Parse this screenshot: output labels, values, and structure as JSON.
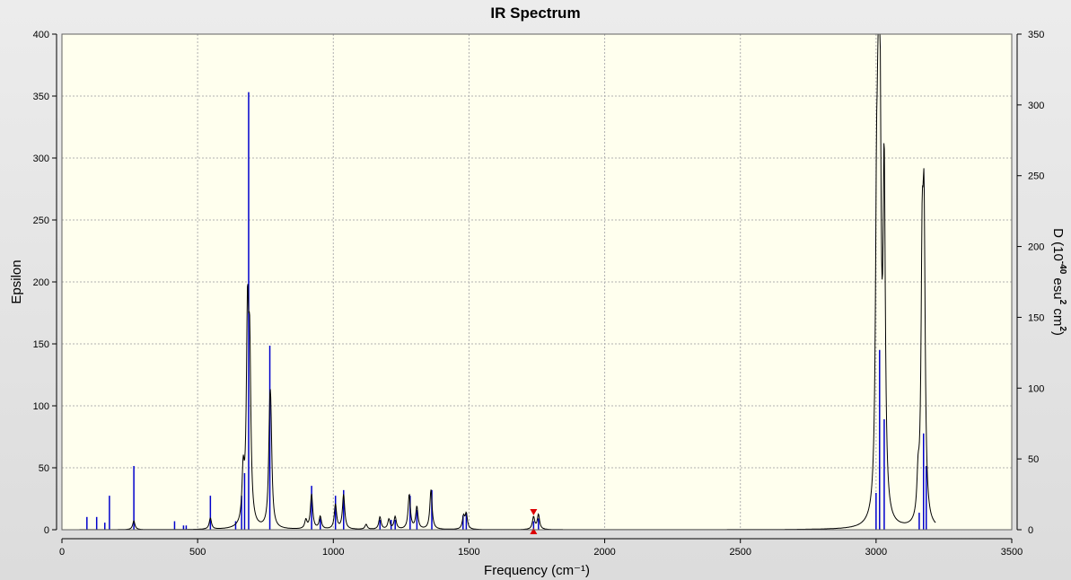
{
  "window": {
    "title": "IR Spectrum"
  },
  "chart_data": {
    "type": "line",
    "title": "IR Spectrum",
    "xlabel": "Frequency (cm⁻¹)",
    "ylabel": "Epsilon",
    "y2label_parts": [
      "D (10",
      "-40",
      " esu",
      "2",
      " cm",
      "2",
      ")"
    ],
    "xlim": [
      0,
      3500
    ],
    "ylim": [
      0,
      400
    ],
    "y2lim": [
      0,
      350
    ],
    "x_ticks": [
      0,
      500,
      1000,
      1500,
      2000,
      2500,
      3000,
      3500
    ],
    "y_ticks": [
      0,
      50,
      100,
      150,
      200,
      250,
      300,
      350,
      400
    ],
    "y2_ticks": [
      0,
      50,
      100,
      150,
      200,
      250,
      300,
      350
    ],
    "grid": true,
    "colors": {
      "spectrum": "#000000",
      "sticks": "#0000cc",
      "markers": "#dd0000",
      "plot_bg": "#ffffee",
      "grid": "#b0b0b0"
    },
    "series": [
      {
        "kind": "stick",
        "axis": "y2",
        "x": [
          92,
          128,
          158,
          175,
          265,
          415,
          448,
          458,
          547,
          640,
          662,
          673,
          688,
          766,
          920,
          952,
          1008,
          1038,
          1172,
          1213,
          1228,
          1283,
          1308,
          1363,
          1478,
          1490,
          1738,
          1756,
          3000,
          3013,
          3030,
          3159,
          3175,
          3185
        ],
        "values": [
          9,
          9,
          5,
          24,
          45,
          6,
          3,
          3,
          24,
          6,
          24,
          40,
          309,
          130,
          31,
          8,
          24,
          28,
          7,
          7,
          7,
          24,
          14,
          28,
          10,
          12,
          6,
          8,
          26,
          127,
          78,
          12,
          68,
          45
        ]
      },
      {
        "kind": "spectrum",
        "axis": "y",
        "peaks": {
          "x": [
            265,
            547,
            668,
            684,
            692,
            766,
            770,
            899,
            920,
            952,
            1008,
            1038,
            1121,
            1172,
            1205,
            1228,
            1280,
            1308,
            1360,
            1480,
            1490,
            1738,
            1756,
            3002,
            3010,
            3015,
            3030,
            3155,
            3170,
            3177
          ],
          "values": [
            7,
            9,
            40,
            160,
            125,
            70,
            60,
            7,
            28,
            10,
            20,
            28,
            4,
            10,
            8,
            10,
            28,
            18,
            32,
            10,
            12,
            10,
            12,
            200,
            330,
            200,
            270,
            30,
            190,
            220
          ]
        }
      }
    ],
    "markers": [
      {
        "x": 1738,
        "y": 13,
        "direction": "down"
      },
      {
        "x": 1738,
        "y": 0,
        "direction": "up"
      }
    ]
  }
}
